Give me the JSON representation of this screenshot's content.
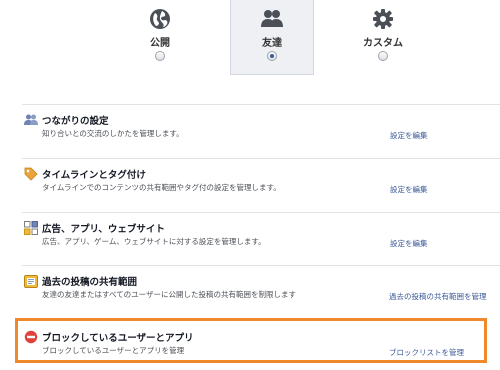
{
  "audience": {
    "options": [
      {
        "label": "公開",
        "icon": "globe-icon",
        "selected": false
      },
      {
        "label": "友達",
        "icon": "friends-icon",
        "selected": true
      },
      {
        "label": "カスタム",
        "icon": "gear-icon",
        "selected": false
      }
    ]
  },
  "settings": [
    {
      "icon": "connections-icon",
      "title": "つながりの設定",
      "description": "知り合いとの交流のしかたを管理します。",
      "link": "設定を編集"
    },
    {
      "icon": "tag-icon",
      "title": "タイムラインとタグ付け",
      "description": "タイムラインでのコンテンツの共有範囲やタグ付の設定を管理します。",
      "link": "設定を編集"
    },
    {
      "icon": "apps-icon",
      "title": "広告、アプリ、ウェブサイト",
      "description": "広告、アプリ、ゲーム、ウェブサイトに対する設定を管理します。",
      "link": "設定を編集"
    },
    {
      "icon": "past-posts-icon",
      "title": "過去の投稿の共有範囲",
      "description": "友達の友達またはすべてのユーザーに公開した投稿の共有範囲を制限します",
      "link": "過去の投稿の共有範囲を管理"
    },
    {
      "icon": "block-icon",
      "title": "ブロックしているユーザーとアプリ",
      "description": "ブロックしているユーザーとアプリを管理",
      "link": "ブロックリストを管理"
    }
  ],
  "colors": {
    "link": "#3b5998",
    "highlight": "#f0892c",
    "block": "#e0423b"
  }
}
